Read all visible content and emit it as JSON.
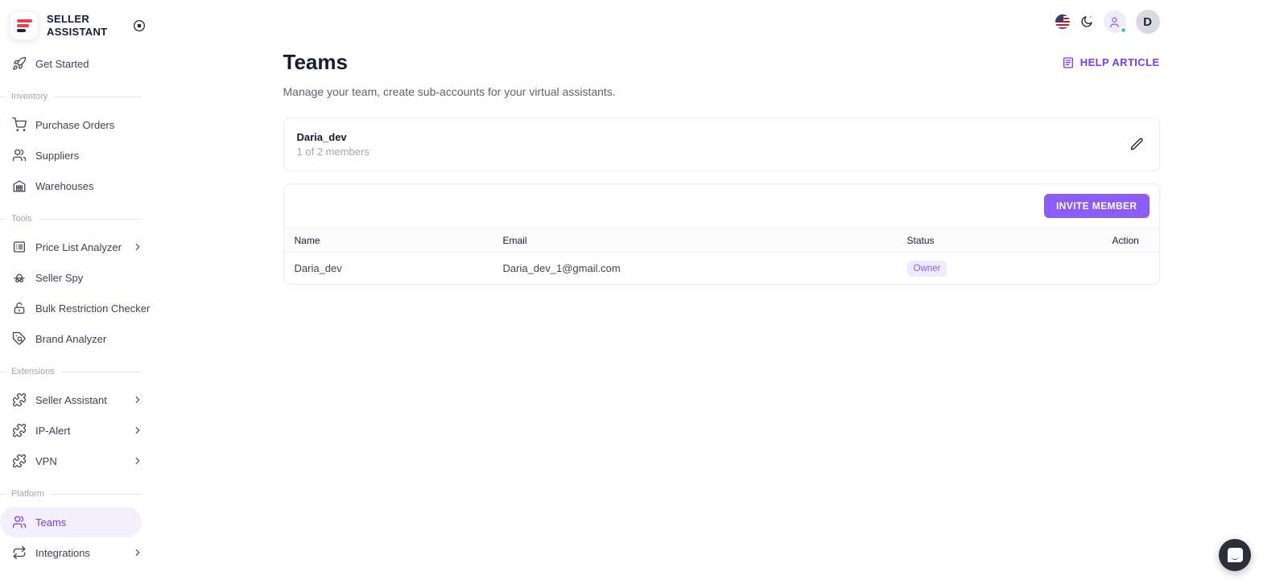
{
  "colors": {
    "accent": "#7c3aed",
    "accent_button": "#8b5cf6",
    "badge_bg": "#efeafd",
    "logo_red": "#ee3d4a",
    "active_item_bg": "#f4effd",
    "online_dot": "#50cd89"
  },
  "brand": {
    "name_line1": "SELLER",
    "name_line2": "ASSISTANT"
  },
  "topbar": {
    "avatar_initial": "D"
  },
  "sidebar": {
    "get_started": "Get Started",
    "sections": [
      {
        "label": "Inventory",
        "items": [
          {
            "label": "Purchase Orders"
          },
          {
            "label": "Suppliers"
          },
          {
            "label": "Warehouses"
          }
        ]
      },
      {
        "label": "Tools",
        "items": [
          {
            "label": "Price List Analyzer"
          },
          {
            "label": "Seller Spy"
          },
          {
            "label": "Bulk Restriction Checker"
          },
          {
            "label": "Brand Analyzer"
          }
        ]
      },
      {
        "label": "Extensions",
        "items": [
          {
            "label": "Seller Assistant"
          },
          {
            "label": "IP-Alert"
          },
          {
            "label": "VPN"
          }
        ]
      },
      {
        "label": "Platform",
        "items": [
          {
            "label": "Teams"
          },
          {
            "label": "Integrations"
          }
        ]
      }
    ]
  },
  "page": {
    "title": "Teams",
    "subtitle": "Manage your team, create sub-accounts for your virtual assistants.",
    "help_link": "HELP ARTICLE"
  },
  "team_card": {
    "name": "Daria_dev",
    "members": "1 of 2 members"
  },
  "members_panel": {
    "invite_button": "INVITE MEMBER",
    "table": {
      "columns": [
        "Name",
        "Email",
        "Status",
        "Action"
      ],
      "rows": [
        {
          "name": "Daria_dev",
          "email": "Daria_dev_1@gmail.com",
          "status": "Owner",
          "action": ""
        }
      ]
    }
  }
}
